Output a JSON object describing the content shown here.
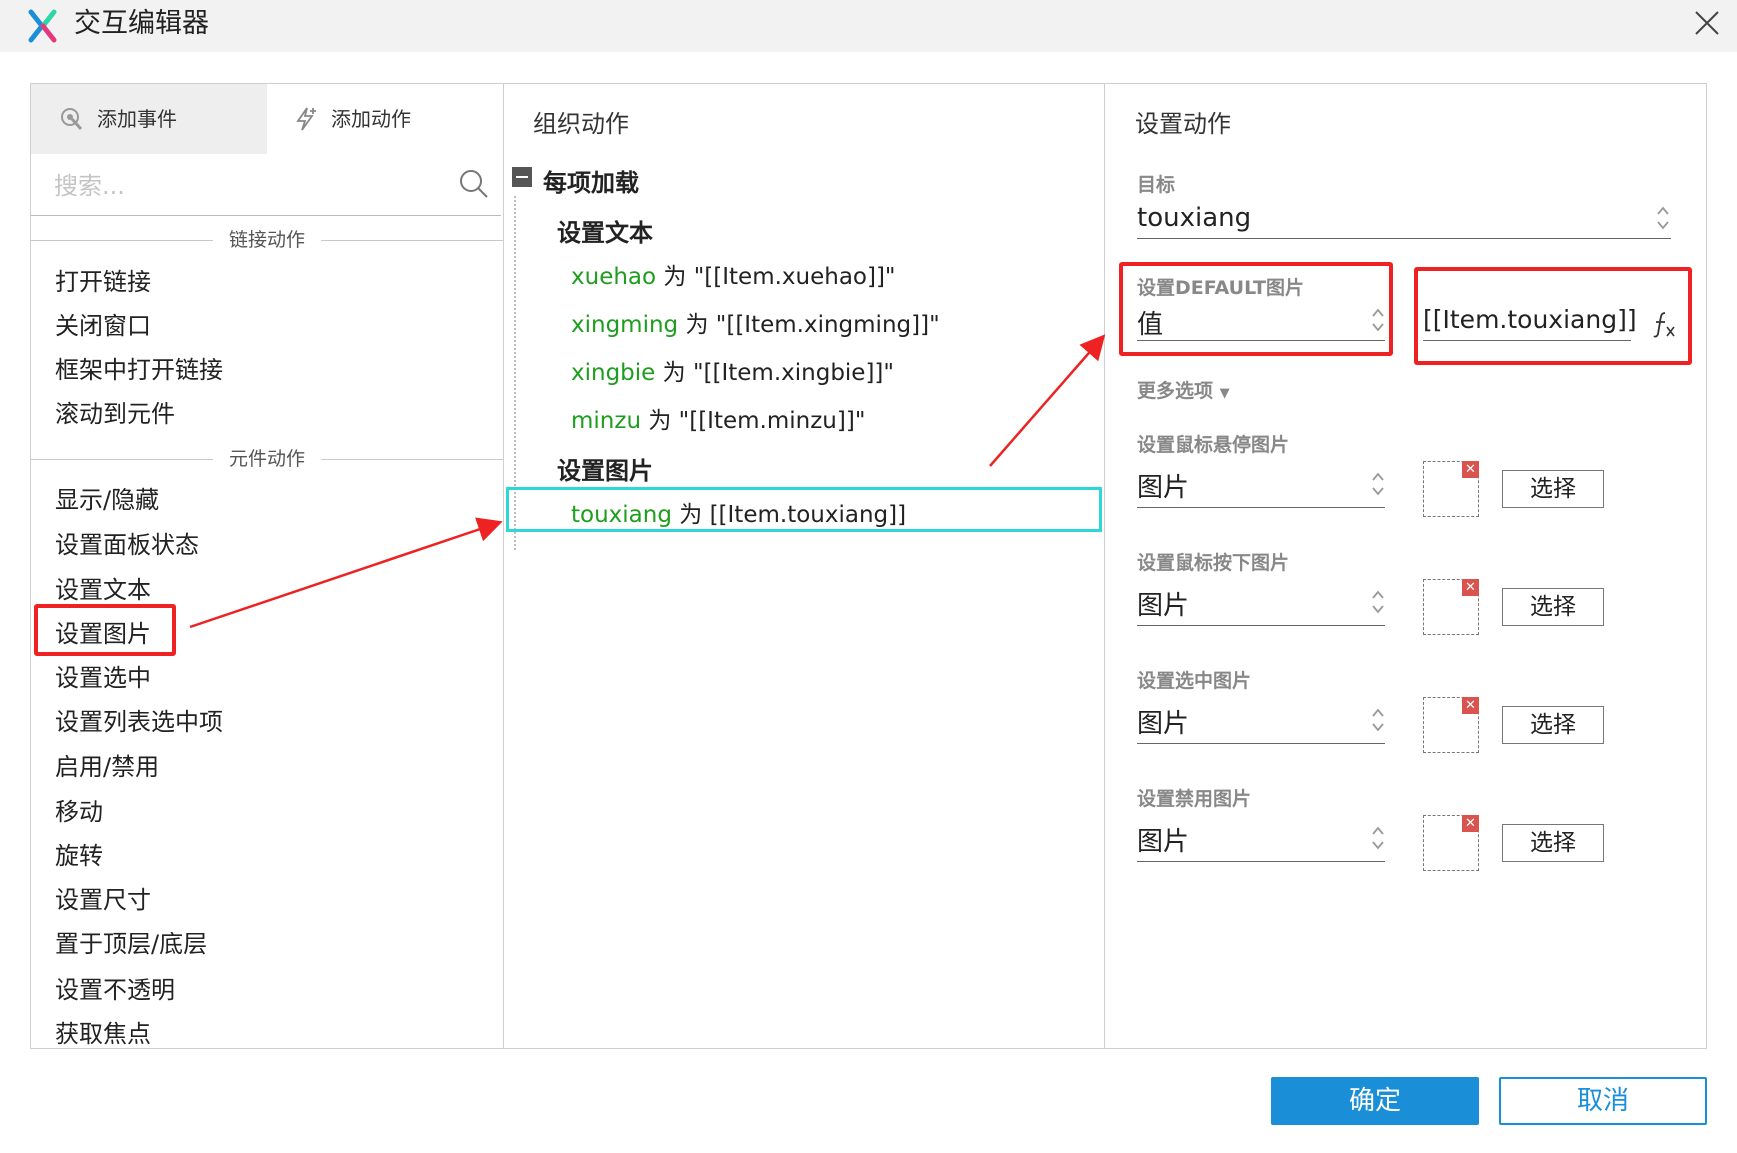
{
  "window": {
    "title": "交互编辑器"
  },
  "left_panel": {
    "tabs": [
      {
        "label": "添加事件"
      },
      {
        "label": "添加动作"
      }
    ],
    "search": {
      "placeholder": "搜索..."
    },
    "sections": [
      {
        "title": "链接动作",
        "items": [
          "打开链接",
          "关闭窗口",
          "框架中打开链接",
          "滚动到元件"
        ]
      },
      {
        "title": "元件动作",
        "items": [
          "显示/隐藏",
          "设置面板状态",
          "设置文本",
          "设置图片",
          "设置选中",
          "设置列表选中项",
          "启用/禁用",
          "移动",
          "旋转",
          "设置尺寸",
          "置于顶层/底层",
          "设置不透明",
          "获取焦点"
        ]
      }
    ]
  },
  "middle_panel": {
    "title": "组织动作",
    "event": "每项加载",
    "groups": [
      {
        "title": "设置文本",
        "actions": [
          {
            "target": "xuehao",
            "text": " 为 \"[[Item.xuehao]]\""
          },
          {
            "target": "xingming",
            "text": " 为 \"[[Item.xingming]]\""
          },
          {
            "target": "xingbie",
            "text": " 为 \"[[Item.xingbie]]\""
          },
          {
            "target": "minzu",
            "text": " 为 \"[[Item.minzu]]\""
          }
        ]
      },
      {
        "title": "设置图片",
        "actions": [
          {
            "target": "touxiang",
            "text": " 为 [[Item.touxiang]]"
          }
        ]
      }
    ]
  },
  "right_panel": {
    "title": "设置动作",
    "target_label": "目标",
    "target_value": "touxiang",
    "default_label": "设置DEFAULT图片",
    "default_type": "值",
    "default_value": "[[Item.touxiang]]",
    "fx_icon": "function-icon",
    "more_options": "更多选项",
    "image_settings": [
      {
        "label": "设置鼠标悬停图片",
        "type": "图片",
        "button": "选择"
      },
      {
        "label": "设置鼠标按下图片",
        "type": "图片",
        "button": "选择"
      },
      {
        "label": "设置选中图片",
        "type": "图片",
        "button": "选择"
      },
      {
        "label": "设置禁用图片",
        "type": "图片",
        "button": "选择"
      }
    ]
  },
  "footer": {
    "ok": "确定",
    "cancel": "取消"
  },
  "colors": {
    "accent": "#1a8fd8",
    "green": "#1e9e1e",
    "highlight": "#2ed6d6",
    "annotation": "#ee2222"
  }
}
